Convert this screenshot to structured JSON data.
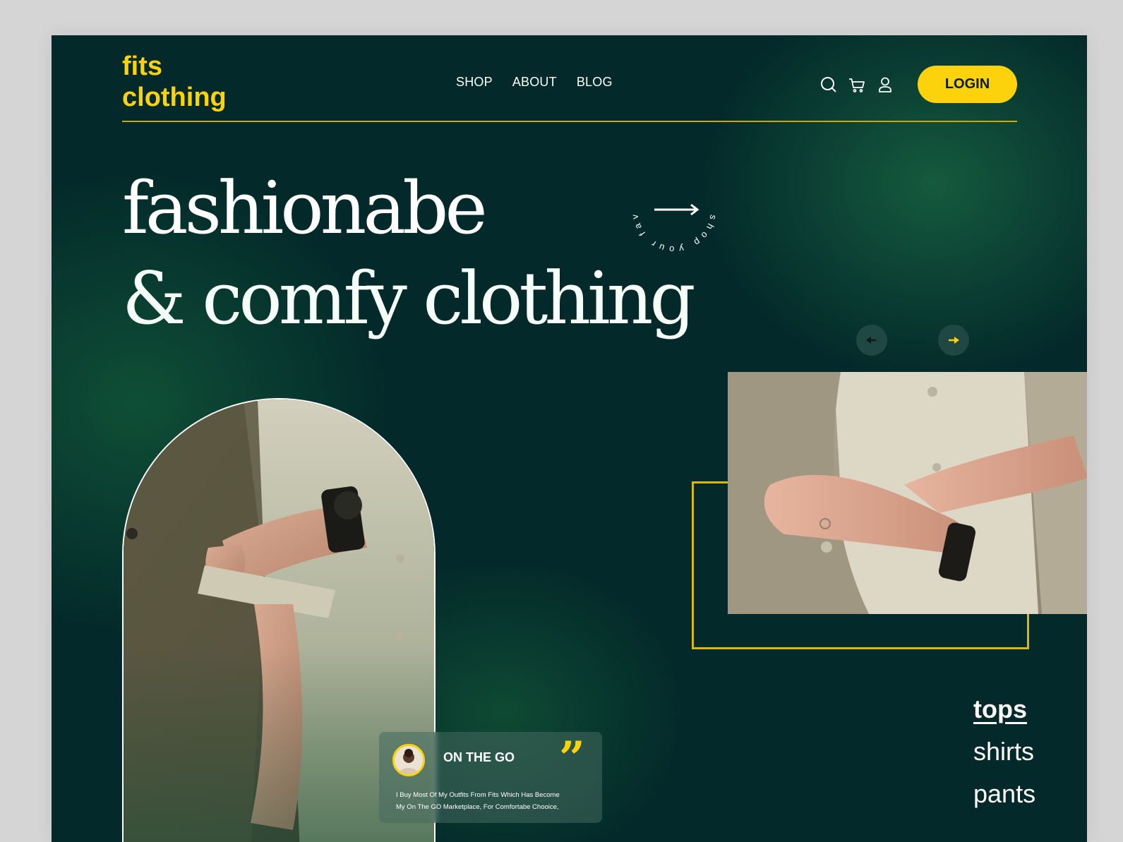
{
  "brand": {
    "line1": "fits",
    "line2": "clothing",
    "color": "#fbd20c"
  },
  "nav": {
    "items": [
      "SHOP",
      "ABOUT",
      "BLOG"
    ]
  },
  "header_icons": [
    "search-icon",
    "cart-icon",
    "user-icon"
  ],
  "login_label": "LOGIN",
  "hero": {
    "headline_line1": "fashionabe",
    "headline_line2": "& comfy clothing",
    "round_link_text": "shop your favourite"
  },
  "slider": {
    "prev_icon": "arrow-left-icon",
    "next_icon": "arrow-right-icon",
    "active": "next"
  },
  "testimonial": {
    "title": "ON THE GO",
    "body_line1": "I Buy Most Of My Outfits From Fits Which Has Become",
    "body_line2": "My On The GO Marketplace, For Comfortabe Chooice,",
    "quote_icon": "quote-icon"
  },
  "categories": {
    "items": [
      "tops",
      "shirts",
      "pants"
    ],
    "active": "tops"
  },
  "colors": {
    "background": "#03292a",
    "accent": "#fbd20c",
    "text": "#ffffff"
  }
}
